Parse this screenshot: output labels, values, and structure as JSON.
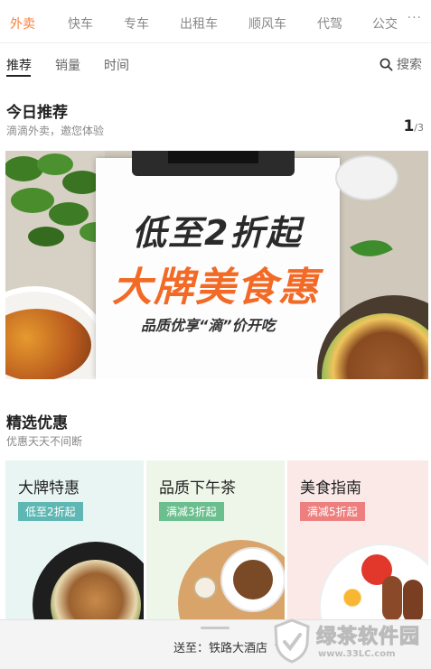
{
  "top_tabs": [
    "外卖",
    "快车",
    "专车",
    "出租车",
    "顺风车",
    "代驾",
    "公交"
  ],
  "top_tabs_active": "外卖",
  "more_label": "···",
  "sort_tabs": [
    "推荐",
    "销量",
    "时间"
  ],
  "search_label": "搜索",
  "today": {
    "title": "今日推荐",
    "subtitle": "滴滴外卖，邀您体验",
    "page_current": "1",
    "page_total": "/3"
  },
  "banner": {
    "line1": "低至2折起",
    "line2": "大牌美食惠",
    "line3": "品质优享“滴”价开吃"
  },
  "offers": {
    "title": "精选优惠",
    "subtitle": "优惠天天不间断",
    "cards": [
      {
        "title": "大牌特惠",
        "tag": "低至2折起",
        "tag_color": "#5fb7b3",
        "bg": "#e8f5f3"
      },
      {
        "title": "品质下午茶",
        "tag": "满减3折起",
        "tag_color": "#6bbf8e",
        "bg": "#eef6ea"
      },
      {
        "title": "美食指南",
        "tag": "满减5折起",
        "tag_color": "#ee7f7f",
        "bg": "#fbe9e8"
      }
    ]
  },
  "bottom": {
    "address": "送至：铁路大酒店"
  },
  "watermark": {
    "name": "绿茶软件园",
    "url": "www.33LC.com"
  },
  "colors": {
    "accent": "#ff7e33"
  }
}
